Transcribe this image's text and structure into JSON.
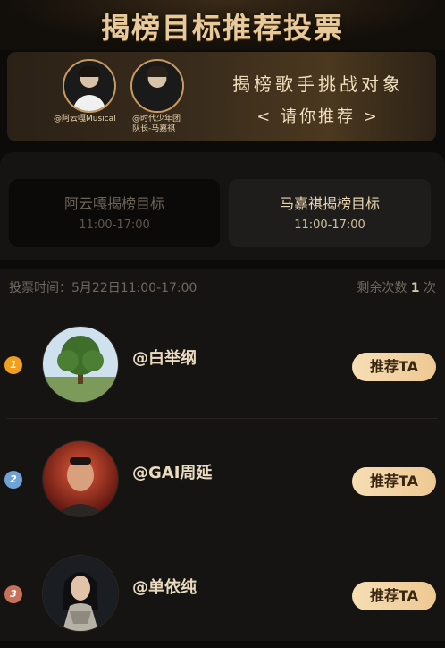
{
  "header": {
    "title": "揭榜目标推荐投票"
  },
  "banner": {
    "idols": [
      {
        "caption": "@阿云嘎Musical"
      },
      {
        "caption_line1": "@时代少年团",
        "caption_line2": "队长-马嘉祺"
      }
    ],
    "heading": "揭榜歌手挑战对象",
    "subheading": "< 请你推荐 >"
  },
  "tabs": [
    {
      "label": "阿云嘎揭榜目标",
      "time": "11:00-17:00",
      "active": false
    },
    {
      "label": "马嘉祺揭榜目标",
      "time": "11:00-17:00",
      "active": true
    }
  ],
  "vote": {
    "time_label": "投票时间：5月22日11:00-17:00",
    "remain_prefix": "剩余次数",
    "remain_count": "1",
    "remain_suffix": "次"
  },
  "candidates": [
    {
      "rank": "1",
      "name": "@白举纲",
      "button": "推荐TA",
      "rank_color": "#f0a01e"
    },
    {
      "rank": "2",
      "name": "@GAI周延",
      "button": "推荐TA",
      "rank_color": "#6fa3d6"
    },
    {
      "rank": "3",
      "name": "@单依纯",
      "button": "推荐TA",
      "rank_color": "#c9705a"
    }
  ],
  "icons": [
    "tree-avatar-icon",
    "man-portrait-icon",
    "woman-portrait-icon"
  ]
}
